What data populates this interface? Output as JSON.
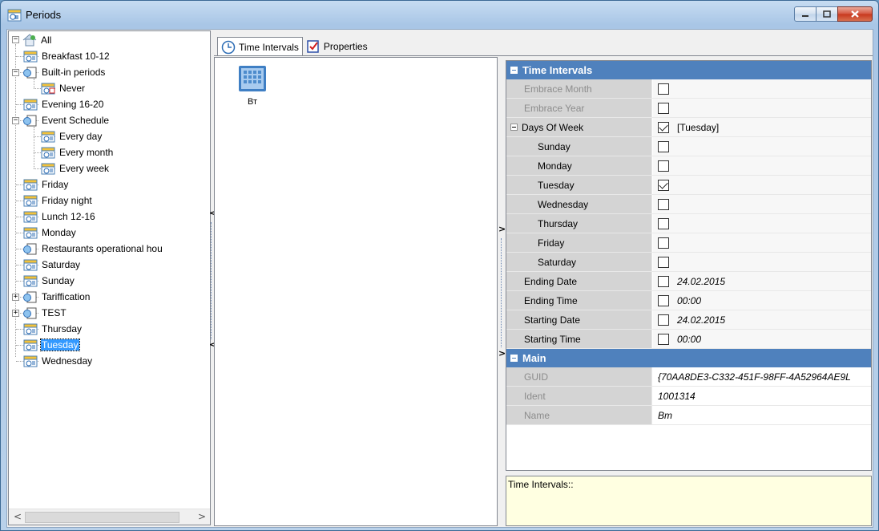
{
  "window": {
    "title": "Periods",
    "buttons": {
      "minimize": "minimize",
      "maximize": "maximize",
      "close": "close"
    }
  },
  "tree": {
    "root": "All",
    "items": [
      {
        "label": "Breakfast 10-12",
        "icon": "calendar-period-icon",
        "level": 1
      },
      {
        "label": "Built-in periods",
        "icon": "group-icon",
        "level": 1,
        "expanded": true
      },
      {
        "label": "Never",
        "icon": "calendar-never-icon",
        "level": 2
      },
      {
        "label": "Evening 16-20",
        "icon": "calendar-period-icon",
        "level": 1
      },
      {
        "label": "Event Schedule",
        "icon": "group-icon",
        "level": 1,
        "expanded": true
      },
      {
        "label": "Every day",
        "icon": "calendar-period-icon",
        "level": 2
      },
      {
        "label": "Every month",
        "icon": "calendar-period-icon",
        "level": 2
      },
      {
        "label": "Every week",
        "icon": "calendar-period-icon",
        "level": 2
      },
      {
        "label": "Friday",
        "icon": "calendar-period-icon",
        "level": 1
      },
      {
        "label": "Friday night",
        "icon": "calendar-period-icon",
        "level": 1
      },
      {
        "label": "Lunch 12-16",
        "icon": "calendar-period-icon",
        "level": 1
      },
      {
        "label": "Monday",
        "icon": "calendar-period-icon",
        "level": 1
      },
      {
        "label": "Restaurants operational hou",
        "icon": "group-icon",
        "level": 1
      },
      {
        "label": "Saturday",
        "icon": "calendar-period-icon",
        "level": 1
      },
      {
        "label": "Sunday",
        "icon": "calendar-period-icon",
        "level": 1
      },
      {
        "label": "Tariffication",
        "icon": "group-icon",
        "level": 1,
        "collapsed": true
      },
      {
        "label": "TEST",
        "icon": "group-icon",
        "level": 1,
        "collapsed": true
      },
      {
        "label": "Thursday",
        "icon": "calendar-period-icon",
        "level": 1
      },
      {
        "label": "Tuesday",
        "icon": "calendar-period-icon",
        "level": 1,
        "selected": true
      },
      {
        "label": "Wednesday",
        "icon": "calendar-period-icon",
        "level": 1
      }
    ]
  },
  "tabs": [
    {
      "label": "Time Intervals",
      "icon": "clock-icon",
      "active": true
    },
    {
      "label": "Properties",
      "icon": "properties-icon",
      "active": false
    }
  ],
  "list": {
    "items": [
      {
        "caption": "Вт",
        "icon": "calendar-large-icon"
      }
    ]
  },
  "propgrid": {
    "categories": [
      {
        "title": "Time Intervals",
        "rows": [
          {
            "name": "Embrace Month",
            "checked": false,
            "value": "",
            "disabled": true
          },
          {
            "name": "Embrace Year",
            "checked": false,
            "value": "",
            "disabled": true
          },
          {
            "name": "Days Of Week",
            "checked": true,
            "value": "[Tuesday]",
            "expandable": true
          },
          {
            "name": "Sunday",
            "checked": false,
            "value": "",
            "indent": true
          },
          {
            "name": "Monday",
            "checked": false,
            "value": "",
            "indent": true
          },
          {
            "name": "Tuesday",
            "checked": true,
            "value": "",
            "indent": true
          },
          {
            "name": "Wednesday",
            "checked": false,
            "value": "",
            "indent": true
          },
          {
            "name": "Thursday",
            "checked": false,
            "value": "",
            "indent": true
          },
          {
            "name": "Friday",
            "checked": false,
            "value": "",
            "indent": true
          },
          {
            "name": "Saturday",
            "checked": false,
            "value": "",
            "indent": true
          },
          {
            "name": "Ending Date",
            "checked": false,
            "value": "24.02.2015",
            "italic": true
          },
          {
            "name": "Ending Time",
            "checked": false,
            "value": "00:00",
            "italic": true
          },
          {
            "name": "Starting Date",
            "checked": false,
            "value": "24.02.2015",
            "italic": true
          },
          {
            "name": "Starting Time",
            "checked": false,
            "value": "00:00",
            "italic": true
          }
        ]
      },
      {
        "title": "Main",
        "rows": [
          {
            "name": "GUID",
            "value": "{70AA8DE3-C332-451F-98FF-4A52964AE9L",
            "disabled": true,
            "italic": true
          },
          {
            "name": "Ident",
            "value": "1001314",
            "disabled": true,
            "italic": true
          },
          {
            "name": "Name",
            "value": "Вт",
            "disabled": true,
            "italic": true
          }
        ]
      }
    ]
  },
  "description": {
    "text": "Time Intervals::"
  },
  "colors": {
    "category_bg": "#4f81bd",
    "selection_bg": "#3399ff",
    "description_bg": "#ffffe1"
  }
}
